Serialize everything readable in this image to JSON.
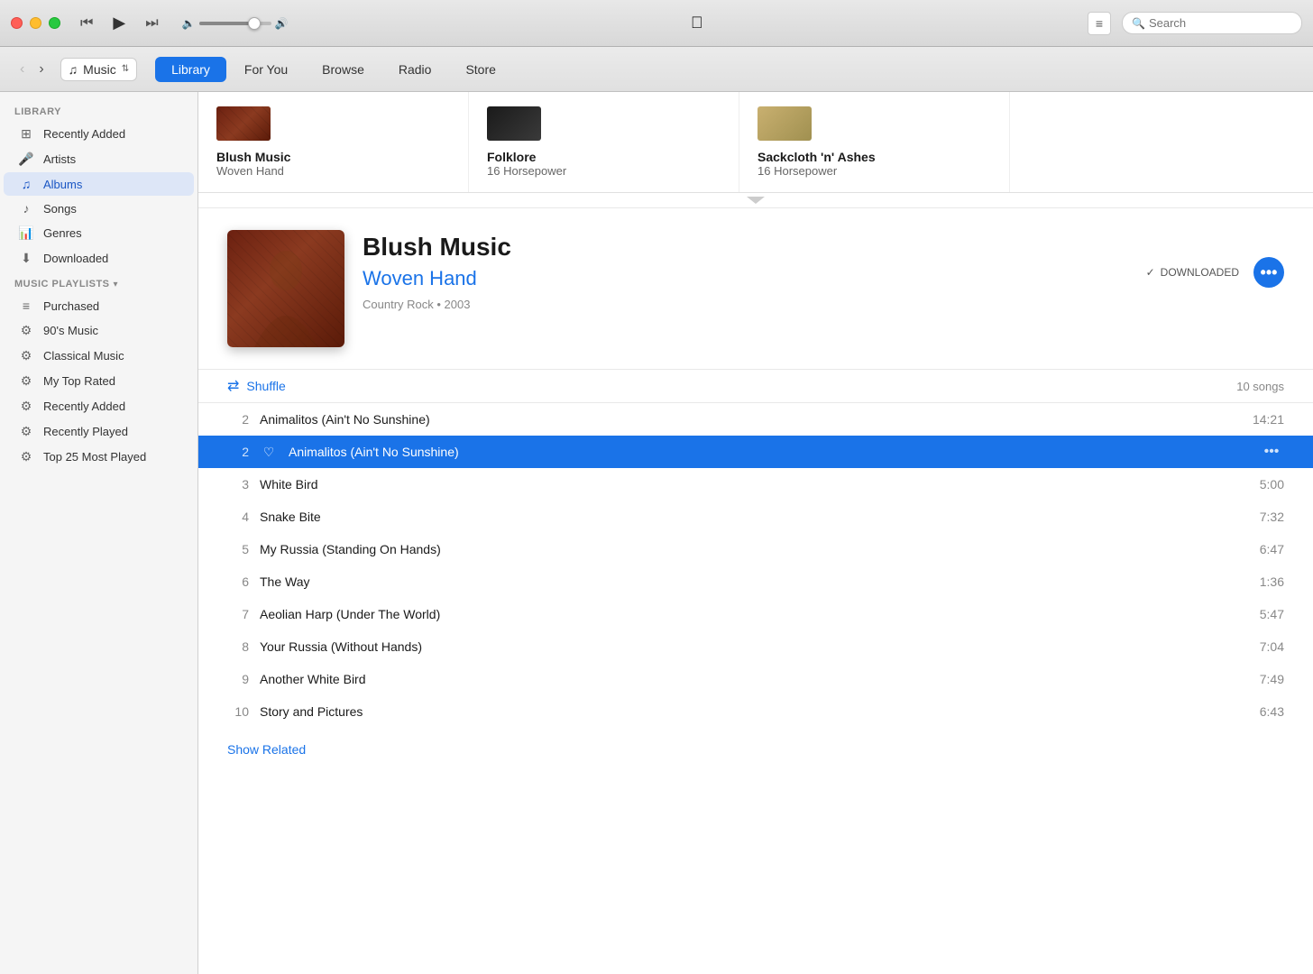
{
  "titlebar": {
    "traffic_lights": {
      "close": "close",
      "minimize": "minimize",
      "maximize": "maximize"
    },
    "rewind_btn": "⏮",
    "play_btn": "▶",
    "forward_btn": "⏭",
    "volume_level": 70,
    "list_btn": "≡",
    "search_placeholder": "Search"
  },
  "navbar": {
    "back_btn": "‹",
    "forward_btn": "›",
    "music_selector_label": "Music",
    "tabs": [
      {
        "id": "library",
        "label": "Library",
        "active": true
      },
      {
        "id": "for-you",
        "label": "For You",
        "active": false
      },
      {
        "id": "browse",
        "label": "Browse",
        "active": false
      },
      {
        "id": "radio",
        "label": "Radio",
        "active": false
      },
      {
        "id": "store",
        "label": "Store",
        "active": false
      }
    ]
  },
  "sidebar": {
    "library_label": "Library",
    "library_items": [
      {
        "id": "recently-added",
        "icon": "⊞",
        "label": "Recently Added",
        "active": false
      },
      {
        "id": "artists",
        "icon": "🎤",
        "label": "Artists",
        "active": false
      },
      {
        "id": "albums",
        "icon": "♫",
        "label": "Albums",
        "active": true
      },
      {
        "id": "songs",
        "icon": "♪",
        "label": "Songs",
        "active": false
      },
      {
        "id": "genres",
        "icon": "📊",
        "label": "Genres",
        "active": false
      },
      {
        "id": "downloaded",
        "icon": "⬇",
        "label": "Downloaded",
        "active": false
      }
    ],
    "playlists_label": "Music Playlists",
    "playlist_items": [
      {
        "id": "purchased",
        "icon": "≡",
        "label": "Purchased"
      },
      {
        "id": "90s-music",
        "icon": "⚙",
        "label": "90's Music"
      },
      {
        "id": "classical",
        "icon": "⚙",
        "label": "Classical Music"
      },
      {
        "id": "top-rated",
        "icon": "⚙",
        "label": "My Top Rated"
      },
      {
        "id": "recently-added-pl",
        "icon": "⚙",
        "label": "Recently Added"
      },
      {
        "id": "recently-played",
        "icon": "⚙",
        "label": "Recently Played"
      },
      {
        "id": "top-25",
        "icon": "⚙",
        "label": "Top 25 Most Played"
      }
    ]
  },
  "album_strip": [
    {
      "title": "Blush Music",
      "artist": "Woven Hand"
    },
    {
      "title": "Folklore",
      "artist": "16 Horsepower"
    },
    {
      "title": "Sackcloth 'n' Ashes",
      "artist": "16 Horsepower"
    }
  ],
  "album_detail": {
    "title": "Blush Music",
    "artist": "Woven Hand",
    "meta": "Country Rock • 2003",
    "downloaded_label": "DOWNLOADED",
    "more_btn_label": "•••"
  },
  "track_list": {
    "shuffle_label": "Shuffle",
    "song_count": "10 songs",
    "tracks": [
      {
        "num": "2",
        "title": "Animalitos (Ain't No Sunshine)",
        "duration": "14:21",
        "selected": false,
        "heart": false
      },
      {
        "num": "2",
        "title": "Animalitos (Ain't No Sunshine)",
        "duration": "",
        "selected": true,
        "heart": true
      },
      {
        "num": "3",
        "title": "White Bird",
        "duration": "5:00",
        "selected": false,
        "heart": false
      },
      {
        "num": "4",
        "title": "Snake Bite",
        "duration": "7:32",
        "selected": false,
        "heart": false
      },
      {
        "num": "5",
        "title": "My Russia (Standing On Hands)",
        "duration": "6:47",
        "selected": false,
        "heart": false
      },
      {
        "num": "6",
        "title": "The Way",
        "duration": "1:36",
        "selected": false,
        "heart": false
      },
      {
        "num": "7",
        "title": "Aeolian Harp (Under The World)",
        "duration": "5:47",
        "selected": false,
        "heart": false
      },
      {
        "num": "8",
        "title": "Your Russia (Without Hands)",
        "duration": "7:04",
        "selected": false,
        "heart": false
      },
      {
        "num": "9",
        "title": "Another White Bird",
        "duration": "7:49",
        "selected": false,
        "heart": false
      },
      {
        "num": "10",
        "title": "Story and Pictures",
        "duration": "6:43",
        "selected": false,
        "heart": false
      }
    ],
    "show_related_label": "Show Related"
  }
}
